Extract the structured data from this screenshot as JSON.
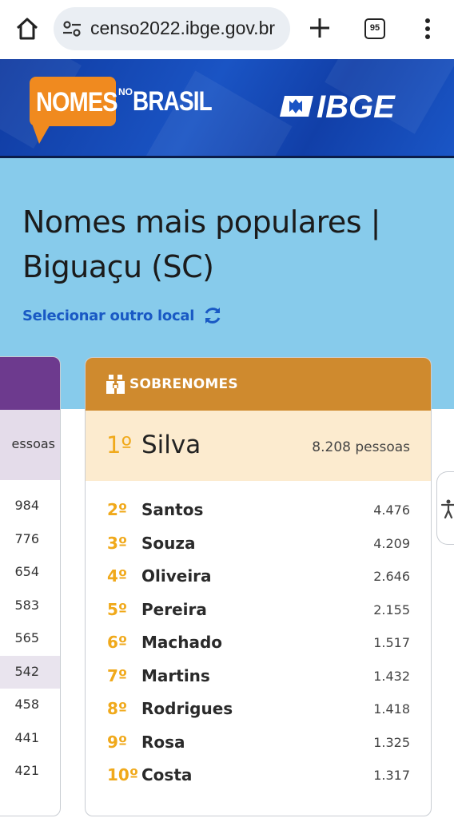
{
  "browser": {
    "url": "censo2022.ibge.gov.br",
    "tab_count": "95",
    "icons": [
      "home-icon",
      "site-settings-icon",
      "plus-icon",
      "tab-switcher-icon",
      "more-vert-icon"
    ]
  },
  "banner": {
    "logo_word1": "NOMES",
    "logo_word2": "NO",
    "logo_word3": "BRASIL",
    "org_logo": "IBGE",
    "brand_color": "#f08a1f"
  },
  "page": {
    "title": "Nomes mais populares | Biguaçu (SC)",
    "select_location": "Selecionar outro local"
  },
  "left_card": {
    "accent_color": "#6d3a8e",
    "first_count_fragment": "essoas",
    "counts": [
      "984",
      "776",
      "654",
      "583",
      "565",
      "542",
      "458",
      "441",
      "421"
    ]
  },
  "surnames_card": {
    "header": "SOBRENOMES",
    "accent_color": "#cf8a2e",
    "rank_color": "#f0a91b",
    "first": {
      "rank": "1º",
      "name": "Silva",
      "count": "8.208 pessoas"
    },
    "rows": [
      {
        "rank": "2º",
        "name": "Santos",
        "count": "4.476"
      },
      {
        "rank": "3º",
        "name": "Souza",
        "count": "4.209"
      },
      {
        "rank": "4º",
        "name": "Oliveira",
        "count": "2.646"
      },
      {
        "rank": "5º",
        "name": "Pereira",
        "count": "2.155"
      },
      {
        "rank": "6º",
        "name": "Machado",
        "count": "1.517"
      },
      {
        "rank": "7º",
        "name": "Martins",
        "count": "1.432"
      },
      {
        "rank": "8º",
        "name": "Rodrigues",
        "count": "1.418"
      },
      {
        "rank": "9º",
        "name": "Rosa",
        "count": "1.325"
      },
      {
        "rank": "10º",
        "name": "Costa",
        "count": "1.317"
      }
    ]
  }
}
